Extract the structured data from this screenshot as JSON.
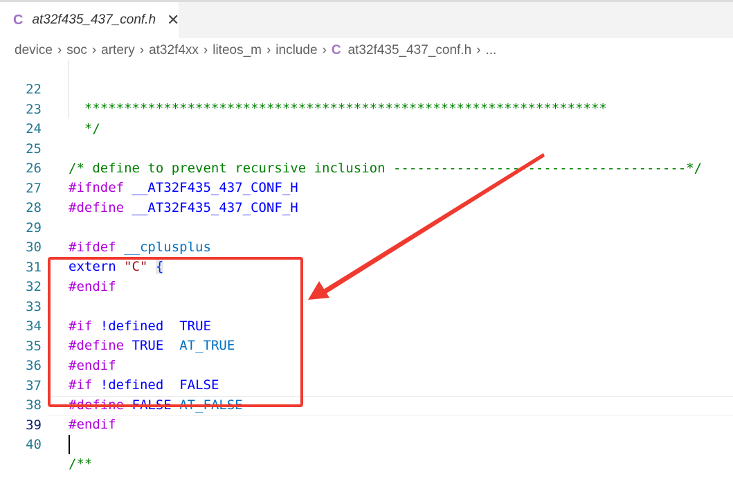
{
  "tab": {
    "icon": "C",
    "title": "at32f435_437_conf.h",
    "close": "✕"
  },
  "breadcrumb": {
    "items": [
      "device",
      "soc",
      "artery",
      "at32f4xx",
      "liteos_m",
      "include"
    ],
    "file_icon": "C",
    "file": "at32f435_437_conf.h",
    "ellipsis": "...",
    "sep": "›"
  },
  "lines": {
    "22": {
      "num": "22",
      "text": "  ******************************************************************"
    },
    "23": {
      "num": "23",
      "text": "  */"
    },
    "24": {
      "num": "24"
    },
    "25": {
      "num": "25",
      "text": "/* define to prevent recursive inclusion -------------------------------------*/"
    },
    "26": {
      "num": "26",
      "kw": "#ifndef",
      "ident": "__AT32F435_437_CONF_H"
    },
    "27": {
      "num": "27",
      "kw": "#define",
      "ident": "__AT32F435_437_CONF_H"
    },
    "28": {
      "num": "28"
    },
    "29": {
      "num": "29",
      "kw": "#ifdef",
      "ident": "__cplusplus"
    },
    "30": {
      "num": "30",
      "kw": "extern",
      "str": "\"C\"",
      "brace": "{"
    },
    "31": {
      "num": "31",
      "kw": "#endif"
    },
    "32": {
      "num": "32"
    },
    "33": {
      "num": "33",
      "kw": "#if",
      "op": "!defined",
      "ident": "TRUE"
    },
    "34": {
      "num": "34",
      "kw": "#define",
      "name": "TRUE",
      "value": "AT_TRUE"
    },
    "35": {
      "num": "35",
      "kw": "#endif"
    },
    "36": {
      "num": "36",
      "kw": "#if",
      "op": "!defined",
      "ident": "FALSE"
    },
    "37": {
      "num": "37",
      "kw": "#define",
      "name": "FALSE",
      "value": "AT_FALSE"
    },
    "38": {
      "num": "38",
      "kw": "#endif"
    },
    "39": {
      "num": "39"
    },
    "40": {
      "num": "40",
      "text": "/**"
    }
  },
  "colors": {
    "annotation": "#f03a2f",
    "comment": "#008000",
    "keyword": "#af00db",
    "line_number": "#237893"
  }
}
